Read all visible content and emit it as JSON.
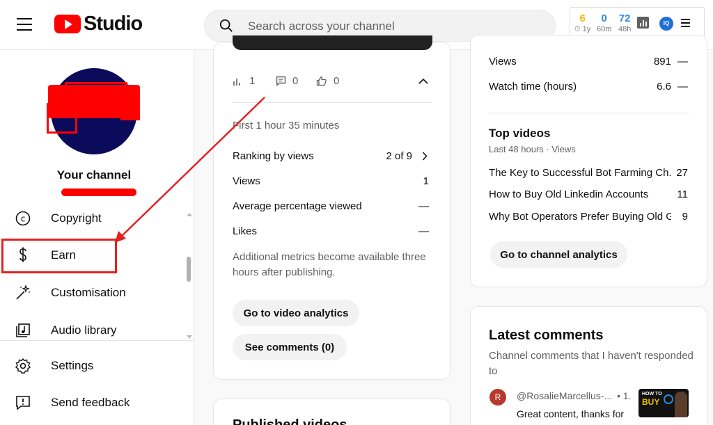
{
  "header": {
    "logo_text": "Studio",
    "search_placeholder": "Search across your channel",
    "extension": {
      "stats": [
        {
          "value": "6",
          "label": "1y",
          "color": "#f2b705"
        },
        {
          "value": "0",
          "label": "60m",
          "color": "#2e8bd8"
        },
        {
          "value": "72",
          "label": "48h",
          "color": "#2e8bd8"
        }
      ],
      "badge": "IQ"
    }
  },
  "sidebar": {
    "channel_label": "Your channel",
    "items": [
      {
        "label": "Copyright",
        "icon": "copyright-icon"
      },
      {
        "label": "Earn",
        "icon": "dollar-icon"
      },
      {
        "label": "Customisation",
        "icon": "magic-wand-icon"
      },
      {
        "label": "Audio library",
        "icon": "audio-library-icon"
      }
    ],
    "bottom_items": [
      {
        "label": "Settings",
        "icon": "gear-icon"
      },
      {
        "label": "Send feedback",
        "icon": "feedback-icon"
      }
    ]
  },
  "video_card": {
    "stats": {
      "views": "1",
      "comments": "0",
      "likes": "0"
    },
    "period": "First 1 hour 35 minutes",
    "rows": [
      {
        "label": "Ranking by views",
        "value": "2 of 9"
      },
      {
        "label": "Views",
        "value": "1"
      },
      {
        "label": "Average percentage viewed",
        "value": "—"
      },
      {
        "label": "Likes",
        "value": "—"
      }
    ],
    "note": "Additional metrics become available three hours after publishing.",
    "analytics_button": "Go to video analytics",
    "comments_button": "See comments (0)",
    "next_card_title": "Published videos"
  },
  "channel_card": {
    "rows": [
      {
        "label": "Views",
        "value": "891",
        "trend": "—"
      },
      {
        "label": "Watch time (hours)",
        "value": "6.6",
        "trend": "—"
      }
    ],
    "top_videos_title": "Top videos",
    "top_videos_subtitle": "Last 48 hours · Views",
    "top_videos": [
      {
        "title": "The Key to Successful Bot Farming Ch...",
        "views": "27"
      },
      {
        "title": "How to Buy Old Linkedin Accounts",
        "views": "11"
      },
      {
        "title": "Why Bot Operators Prefer Buying Old G...",
        "views": "9"
      }
    ],
    "analytics_button": "Go to channel analytics"
  },
  "comments_card": {
    "title": "Latest comments",
    "subtitle": "Channel comments that I haven't responded to",
    "comment": {
      "avatar_letter": "R",
      "author": "@RosalieMarcellus-...",
      "time": "• 1.",
      "text": "Great content, thanks for",
      "thumb_line1": "HOW TO",
      "thumb_line2": "BUY"
    }
  }
}
